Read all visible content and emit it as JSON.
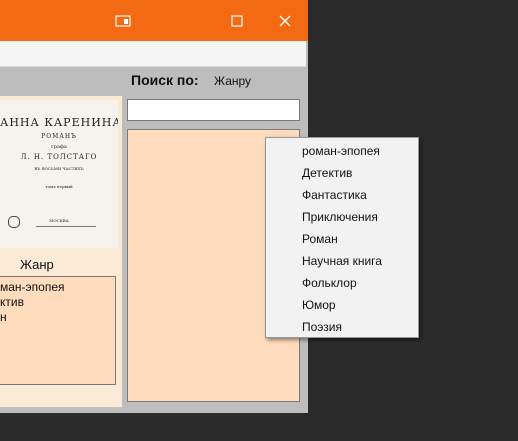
{
  "window": {
    "titlebar_color": "#f36a12",
    "icons": [
      "snap-layout-icon",
      "maximize-icon",
      "close-icon"
    ]
  },
  "search": {
    "label": "Поиск по:",
    "criterion": "Жанру",
    "input_value": ""
  },
  "book": {
    "cover_lines": [
      "АННА КАРЕНИНА",
      "РОМАНЪ",
      "графа",
      "Л. Н. ТОЛСТАГО",
      "ВЪ ВОСЬМИ ЧАСТЯХЪ",
      "томъ первый",
      "МОСКВА"
    ],
    "genre_caption": "Жанр",
    "genres_visible": [
      "ман-эпопея",
      "ктив",
      "н"
    ]
  },
  "dropdown": {
    "items": [
      "роман-эпопея",
      "Детектив",
      "Фантастика",
      "Приключения",
      "Роман",
      "Научная книга",
      "Фольклор",
      "Юмор",
      "Поэзия"
    ]
  },
  "colors": {
    "desktop": "#2b2b2b",
    "panel_peach": "#ffdcbd",
    "book_panel": "#faead6"
  }
}
